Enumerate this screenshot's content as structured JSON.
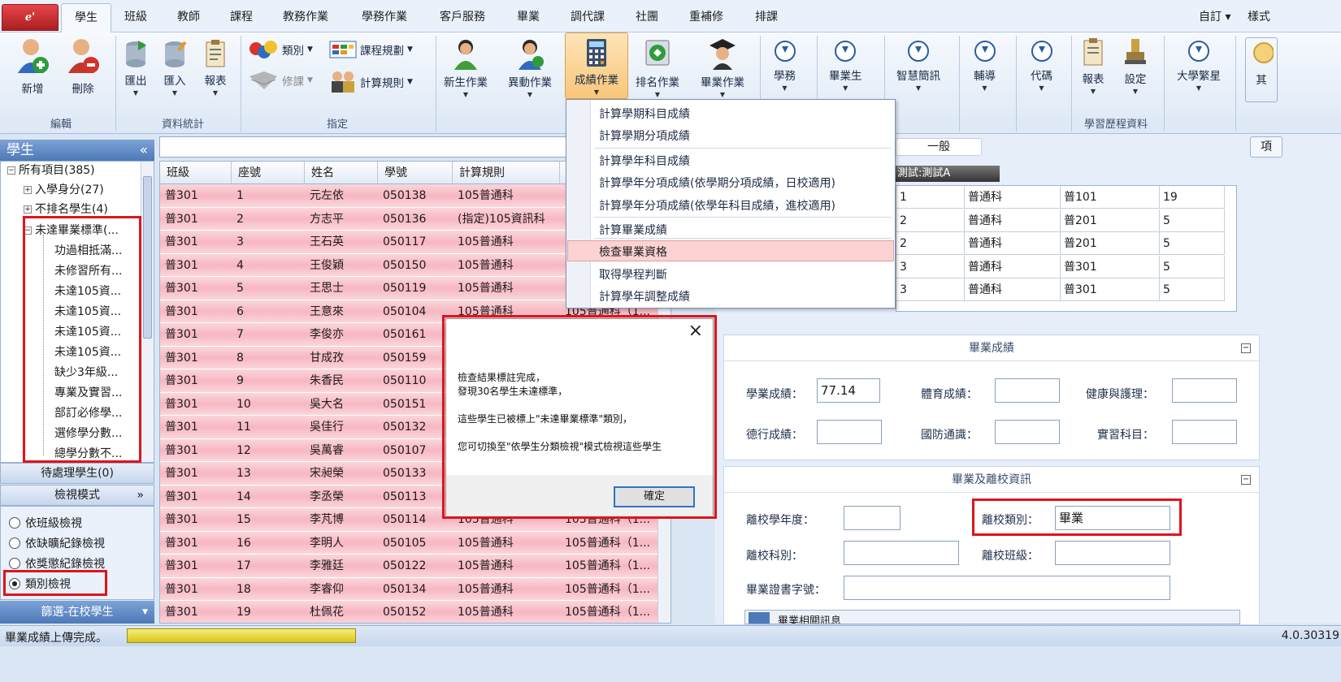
{
  "app_button": "ℯ'",
  "tabs": [
    "學生",
    "班級",
    "教師",
    "課程",
    "教務作業",
    "學務作業",
    "客戶服務",
    "畢業",
    "調代課",
    "社團",
    "重補修",
    "排課"
  ],
  "tabs_right": [
    "自訂",
    "樣式"
  ],
  "ribbon": {
    "edit": {
      "add": "新增",
      "delete": "刪除",
      "label": "編輯"
    },
    "stats": {
      "export": "匯出",
      "import": "匯入",
      "report": "報表",
      "label": "資料統計"
    },
    "assign": {
      "category": "類別",
      "course_plan": "課程規劃",
      "repair": "修課",
      "calc_rule": "計算規則",
      "label": "指定"
    },
    "ops": {
      "new_student": "新生作業",
      "transfer": "異動作業",
      "score": "成績作業",
      "rank": "排名作業",
      "graduate": "畢業作業"
    },
    "more": {
      "affairs": "學務",
      "graduates": "畢業生",
      "smart": "智慧簡訊",
      "counsel": "輔導",
      "code": "代碼",
      "report": "報表",
      "settings": "設定",
      "label": "學習歷程資料",
      "univ": "大學繁星",
      "other": "其"
    }
  },
  "left_panel": {
    "title": "學生",
    "collapse": "«",
    "tree": {
      "all": "所有項目(385)",
      "admission": "入學身分(27)",
      "unranked": "不排名學生(4)",
      "unmet": "未達畢業標準(...",
      "children": [
        "功過相抵滿...",
        "未修習所有...",
        "未達105資...",
        "未達105資...",
        "未達105資...",
        "未達105資...",
        "缺少3年級...",
        "專業及實習...",
        "部訂必修學...",
        "選修學分數...",
        "總學分數不..."
      ]
    },
    "pending": "待處理學生(0)",
    "view_mode": "檢視模式",
    "radios": [
      "依班級檢視",
      "依缺曠紀錄檢視",
      "依獎懲紀錄檢視",
      "類別檢視"
    ],
    "selected_radio": 3,
    "filter": "篩選-在校學生"
  },
  "grid": {
    "headers": [
      "班級",
      "座號",
      "姓名",
      "學號",
      "計算規則"
    ],
    "rows": [
      [
        "普301",
        "1",
        "元左依",
        "050138",
        "105普通科",
        ""
      ],
      [
        "普301",
        "2",
        "方志平",
        "050136",
        "(指定)105資訊科",
        ""
      ],
      [
        "普301",
        "3",
        "王石英",
        "050117",
        "105普通科",
        ""
      ],
      [
        "普301",
        "4",
        "王俊穎",
        "050150",
        "105普通科",
        ""
      ],
      [
        "普301",
        "5",
        "王思士",
        "050119",
        "105普通科",
        ""
      ],
      [
        "普301",
        "6",
        "王意來",
        "050104",
        "105普通科",
        "105普通科（1..."
      ],
      [
        "普301",
        "7",
        "李俊亦",
        "050161",
        "",
        ""
      ],
      [
        "普301",
        "8",
        "甘成孜",
        "050159",
        "",
        ""
      ],
      [
        "普301",
        "9",
        "朱香民",
        "050110",
        "",
        ""
      ],
      [
        "普301",
        "10",
        "吳大名",
        "050151",
        "",
        ""
      ],
      [
        "普301",
        "11",
        "吳佳行",
        "050132",
        "",
        ""
      ],
      [
        "普301",
        "12",
        "吳萬睿",
        "050107",
        "",
        ""
      ],
      [
        "普301",
        "13",
        "宋昶榮",
        "050133",
        "",
        ""
      ],
      [
        "普301",
        "14",
        "李丞榮",
        "050113",
        "",
        ""
      ],
      [
        "普301",
        "15",
        "李芃博",
        "050114",
        "105普通科",
        "105普通科（1..."
      ],
      [
        "普301",
        "16",
        "李明人",
        "050105",
        "105普通科",
        "105普通科（1..."
      ],
      [
        "普301",
        "17",
        "李雅廷",
        "050122",
        "105普通科",
        "105普通科（1..."
      ],
      [
        "普301",
        "18",
        "李睿仰",
        "050134",
        "105普通科",
        "105普通科（1..."
      ],
      [
        "普301",
        "19",
        "杜佩花",
        "050152",
        "105普通科",
        "105普通科（1..."
      ]
    ]
  },
  "right_panel": {
    "tab_general": "一般",
    "test_label": "測試:測試A",
    "right_btn": "項",
    "subgrid": [
      [
        "1",
        "普通科",
        "普101",
        "19"
      ],
      [
        "2",
        "普通科",
        "普201",
        "5"
      ],
      [
        "2",
        "普通科",
        "普201",
        "5"
      ],
      [
        "3",
        "普通科",
        "普301",
        "5"
      ],
      [
        "3",
        "普通科",
        "普301",
        "5"
      ]
    ],
    "grad_score": {
      "title": "畢業成績",
      "academic_label": "學業成績：",
      "academic_value": "77.14",
      "pe_label": "體育成績：",
      "health_label": "健康與護理：",
      "moral_label": "德行成績：",
      "defense_label": "國防通識：",
      "intern_label": "實習科目："
    },
    "grad_info": {
      "title": "畢業及離校資訊",
      "leave_year_label": "離校學年度：",
      "leave_type_label": "離校類別：",
      "leave_type_value": "畢業",
      "leave_dept_label": "離校科別：",
      "leave_class_label": "離校班級：",
      "cert_label": "畢業證書字號：",
      "related": "畢業相關訊息"
    }
  },
  "dropdown": [
    "計算學期科目成績",
    "計算學期分項成績",
    "計算學年科目成績",
    "計算學年分項成績(依學期分項成績，日校適用)",
    "計算學年分項成績(依學年科目成績，進校適用)",
    "計算畢業成績",
    "檢查畢業資格",
    "取得學程判斷",
    "計算學年調整成績"
  ],
  "dialog": {
    "line1": "檢查結果標註完成，",
    "line2": "發現30名學生未達標準，",
    "line3": "這些學生已被標上\"未達畢業標準\"類別，",
    "line4": "您可切換至\"依學生分類檢視\"模式檢視這些學生",
    "ok": "確定",
    "close": "×"
  },
  "status": {
    "text": "畢業成績上傳完成。",
    "version": "4.0.30319"
  },
  "colors": {
    "highlight_red": "#e0131b",
    "row_pink": "#f7b7c2",
    "ribbon_blue": "#4d79b8"
  }
}
